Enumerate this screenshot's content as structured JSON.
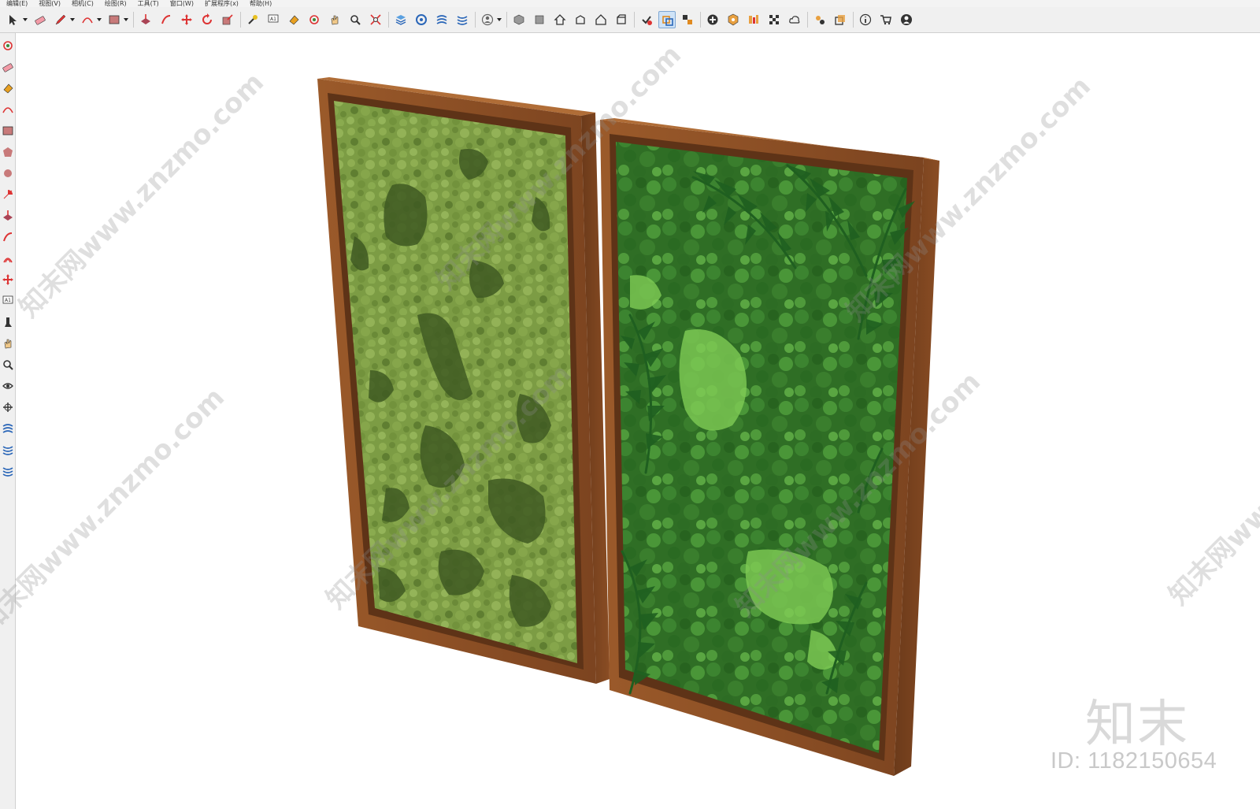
{
  "menu": {
    "items": [
      "编辑(E)",
      "视图(V)",
      "相机(C)",
      "绘图(R)",
      "工具(T)",
      "窗口(W)",
      "扩展程序(x)",
      "帮助(H)"
    ]
  },
  "toolbar": {
    "tools": [
      "select-icon",
      "eraser-icon",
      "pencil-icon",
      "arc-icon",
      "rectangle-icon",
      "pushpull-icon",
      "followme-icon",
      "move-icon",
      "rotate-icon",
      "scale-icon",
      "tape-icon",
      "text-icon",
      "paint-icon",
      "orbit-icon",
      "pan-icon",
      "zoom-icon",
      "zoom-extents-icon",
      "layers-icon",
      "styles-icon",
      "scenes-icon",
      "sandbox-icon",
      "account-icon",
      "iso-view-icon",
      "front-view-icon",
      "home-view-icon",
      "right-view-icon",
      "back-view-icon",
      "left-view-icon",
      "solid-tools-icon",
      "section-icon",
      "components-icon",
      "add-icon",
      "warehouse-icon",
      "extension-icon",
      "checker-icon",
      "cloud-icon",
      "settings-icon",
      "window-icon",
      "info-icon",
      "cart-icon",
      "user-icon"
    ],
    "active_tool": "section-icon"
  },
  "left_tools": [
    "orbit-icon",
    "eraser-icon",
    "paint-icon",
    "arc-icon",
    "rectangle-icon",
    "polygon-icon",
    "circle-icon",
    "pie-icon",
    "pushpull-icon",
    "followme-icon",
    "offset-icon",
    "move-icon",
    "text-icon",
    "walk-icon",
    "pan-icon",
    "zoom-icon",
    "position-camera-icon",
    "lookaround-icon",
    "section-plane-icon",
    "sandbox-icon",
    "sandbox2-icon"
  ],
  "watermark": {
    "text": "知末网www.znzmo.com",
    "brand": "知末",
    "id_text": "ID: 1182150654"
  },
  "colors": {
    "frame_wood": "#8a4e24",
    "frame_wood_light": "#a8642f",
    "moss_light": "#7a9a42",
    "moss_dark": "#3f5a22",
    "foliage_dark": "#1f5f20",
    "foliage_light": "#6fbf4a",
    "toolbar_bg": "#f0f0f0",
    "active_tool_bg": "#cfe3f7"
  }
}
